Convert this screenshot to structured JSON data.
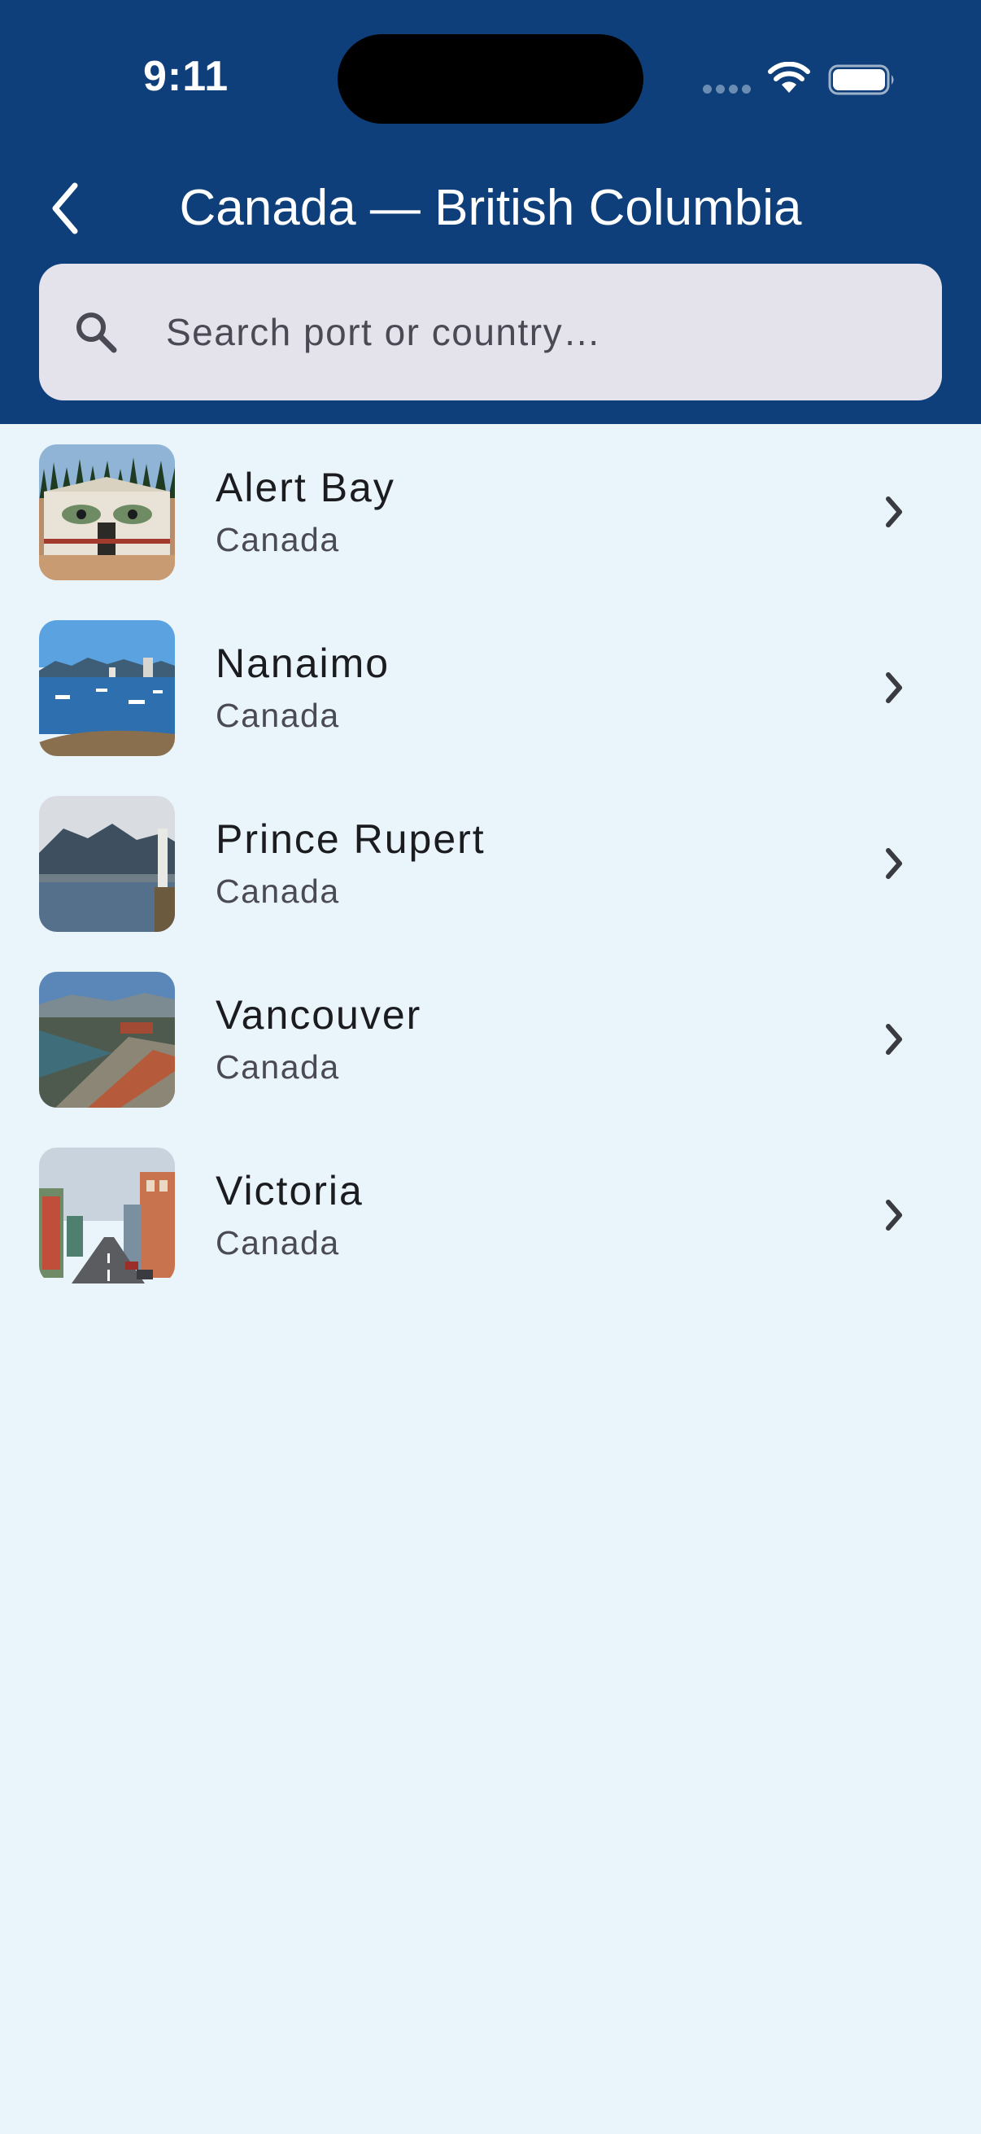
{
  "status_bar": {
    "time": "9:11"
  },
  "header": {
    "title": "Canada — British Columbia",
    "back_icon": "chevron-left-icon"
  },
  "search": {
    "placeholder": "Search port or country…",
    "value": "",
    "icon": "search-icon"
  },
  "ports": [
    {
      "name": "Alert Bay",
      "country": "Canada",
      "image": "totem-longhouse-photo"
    },
    {
      "name": "Nanaimo",
      "country": "Canada",
      "image": "harbour-boats-photo"
    },
    {
      "name": "Prince Rupert",
      "country": "Canada",
      "image": "mountain-harbour-photo"
    },
    {
      "name": "Vancouver",
      "country": "Canada",
      "image": "city-aerial-photo"
    },
    {
      "name": "Victoria",
      "country": "Canada",
      "image": "street-view-photo"
    }
  ],
  "colors": {
    "header_background": "#0E3F7A",
    "page_background": "#EAF4FB",
    "search_background": "#E4E3EC",
    "primary_text": "#1B1C20",
    "secondary_text": "#4A4A55"
  }
}
